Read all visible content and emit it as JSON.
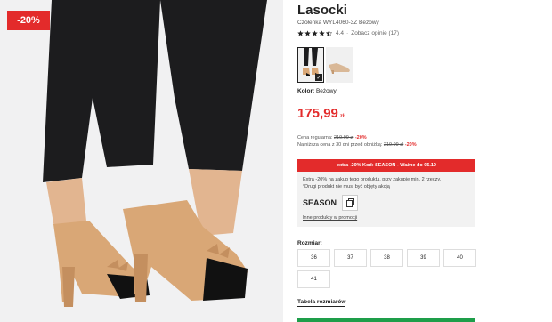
{
  "product": {
    "badge": "-20%",
    "brand": "Lasocki",
    "model": "Czółenka WYL4060-3Z Beżowy",
    "rating_value": "4.4",
    "rating_sep": "·",
    "reviews_link": "Zobacz opinie (17)",
    "color_label": "Kolor:",
    "color_value": "Beżowy",
    "price": "175,99",
    "currency": "zł"
  },
  "pricing": {
    "regular_label": "Cena regularna:",
    "regular_value": "219.99 zł",
    "regular_discount": "-20%",
    "lowest_label": "Najniższa cena z 30 dni przed obniżką:",
    "lowest_value": "219.99 zł",
    "lowest_discount": "-20%"
  },
  "promo": {
    "header": "extra -20% Kod: SEASON - Ważne do 05.10",
    "line1": "Extra -20% na zakup tego produktu, przy zakupie min. 2 rzeczy.",
    "line2": "*Drugi produkt nie musi być objęty akcją",
    "code": "SEASON",
    "link": "Inne produkty w promocji"
  },
  "sizes": {
    "label": "Rozmiar:",
    "options": [
      "36",
      "37",
      "38",
      "39",
      "40",
      "41"
    ]
  },
  "size_chart_link": "Tabela rozmiarów",
  "colors": {
    "accent": "#e32b2b",
    "cta": "#1e9e4a"
  },
  "icons": {
    "star": "star-icon",
    "copy": "copy-icon",
    "check": "check-icon"
  }
}
